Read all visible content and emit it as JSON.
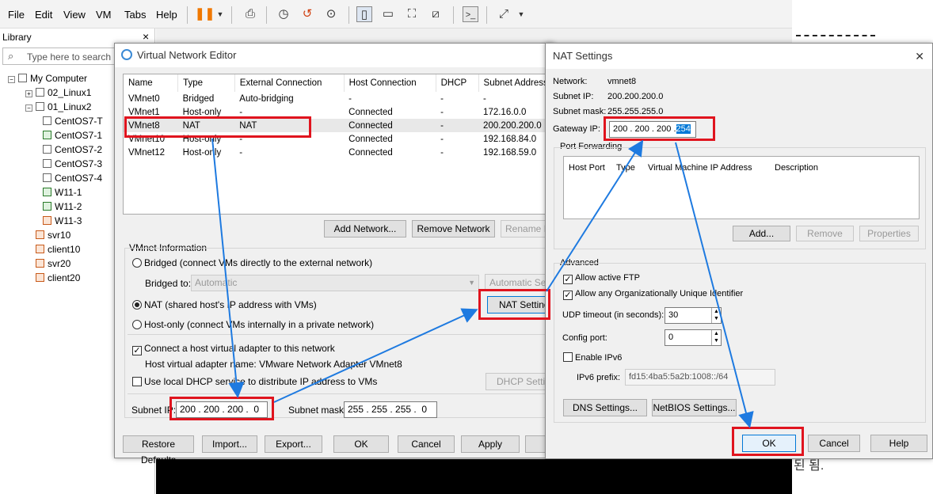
{
  "menu": [
    "File",
    "Edit",
    "View",
    "VM",
    "Tabs",
    "Help"
  ],
  "library": {
    "title": "Library",
    "search_placeholder": "Type here to search",
    "close": "×",
    "tree": [
      {
        "label": "My Computer",
        "indent": 0,
        "icon": "computer-icon"
      },
      {
        "label": "02_Linux1",
        "indent": 1,
        "icon": "folder-icon"
      },
      {
        "label": "01_Linux2",
        "indent": 1,
        "icon": "folder-icon"
      },
      {
        "label": "CentOS7-T",
        "indent": 2,
        "icon": "vm-icon"
      },
      {
        "label": "CentOS7-1",
        "indent": 2,
        "icon": "vm-running-icon"
      },
      {
        "label": "CentOS7-2",
        "indent": 2,
        "icon": "vm-icon"
      },
      {
        "label": "CentOS7-3",
        "indent": 2,
        "icon": "vm-icon"
      },
      {
        "label": "CentOS7-4",
        "indent": 2,
        "icon": "vm-icon"
      },
      {
        "label": "W11-1",
        "indent": 2,
        "icon": "vm-running-icon"
      },
      {
        "label": "W11-2",
        "indent": 2,
        "icon": "vm-running-icon"
      },
      {
        "label": "W11-3",
        "indent": 2,
        "icon": "vm-locked-icon"
      },
      {
        "label": "svr10",
        "indent": 1,
        "icon": "vm-group-icon"
      },
      {
        "label": "client10",
        "indent": 1,
        "icon": "vm-group-icon"
      },
      {
        "label": "svr20",
        "indent": 1,
        "icon": "vm-group-icon"
      },
      {
        "label": "client20",
        "indent": 1,
        "icon": "vm-group-icon"
      }
    ]
  },
  "vne": {
    "title": "Virtual Network Editor",
    "columns": [
      "Name",
      "Type",
      "External Connection",
      "Host Connection",
      "DHCP",
      "Subnet Address"
    ],
    "rows": [
      [
        "VMnet0",
        "Bridged",
        "Auto-bridging",
        "-",
        "-",
        "-"
      ],
      [
        "VMnet1",
        "Host-only",
        "-",
        "Connected",
        "-",
        "172.16.0.0"
      ],
      [
        "VMnet8",
        "NAT",
        "NAT",
        "Connected",
        "-",
        "200.200.200.0"
      ],
      [
        "VMnet10",
        "Host-only",
        "-",
        "Connected",
        "-",
        "192.168.84.0"
      ],
      [
        "VMnet12",
        "Host-only",
        "-",
        "Connected",
        "-",
        "192.168.59.0"
      ]
    ],
    "add_network": "Add Network...",
    "remove_network": "Remove Network",
    "rename_network": "Rename Ne",
    "vmnet_info": "VMnet Information",
    "bridged_label": "Bridged (connect VMs directly to the external network)",
    "bridged_to": "Bridged to:",
    "bridged_value": "Automatic",
    "auto_settings": "Automatic Setti",
    "nat_label": "NAT (shared host's IP address with VMs)",
    "nat_settings": "NAT Settings",
    "hostonly_label": "Host-only (connect VMs internally in a private network)",
    "connect_adapter": "Connect a host virtual adapter to this network",
    "adapter_name": "Host virtual adapter name: VMware Network Adapter VMnet8",
    "dhcp_label": "Use local DHCP service to distribute IP address to VMs",
    "dhcp_settings": "DHCP Settings",
    "subnet_ip_label": "Subnet IP:",
    "subnet_ip": "200 . 200 . 200 .  0",
    "subnet_mask_label": "Subnet mask:",
    "subnet_mask": "255 . 255 . 255 .  0",
    "restore": "Restore Defaults",
    "import": "Import...",
    "export": "Export...",
    "ok": "OK",
    "cancel": "Cancel",
    "apply": "Apply"
  },
  "nat": {
    "title": "NAT Settings",
    "close": "✕",
    "network_label": "Network:",
    "network": "vmnet8",
    "subnet_ip_label": "Subnet IP:",
    "subnet_ip": "200.200.200.0",
    "subnet_mask_label": "Subnet mask:",
    "subnet_mask": "255.255.255.0",
    "gateway_label": "Gateway IP:",
    "gateway_prefix": "200 . 200 . 200 .",
    "gateway_last": "254",
    "port_forwarding": "Port Forwarding",
    "pf_columns": [
      "Host Port",
      "Type",
      "Virtual Machine IP Address",
      "Description"
    ],
    "add": "Add...",
    "remove": "Remove",
    "properties": "Properties",
    "advanced": "Advanced",
    "allow_ftp": "Allow active FTP",
    "allow_oui": "Allow any Organizationally Unique Identifier",
    "udp_label": "UDP timeout (in seconds):",
    "udp_value": "30",
    "config_port_label": "Config port:",
    "config_port": "0",
    "enable_ipv6": "Enable IPv6",
    "ipv6_label": "IPv6 prefix:",
    "ipv6_value": "fd15:4ba5:5a2b:1008::/64",
    "dns": "DNS Settings...",
    "netbios": "NetBIOS Settings...",
    "ok": "OK",
    "cancel": "Cancel",
    "help": "Help"
  },
  "background": {
    "korean_text": "된 됨."
  },
  "colors": {
    "highlight": "#e0141e",
    "arrow": "#1e7ae0",
    "selection": "#0078d7"
  }
}
